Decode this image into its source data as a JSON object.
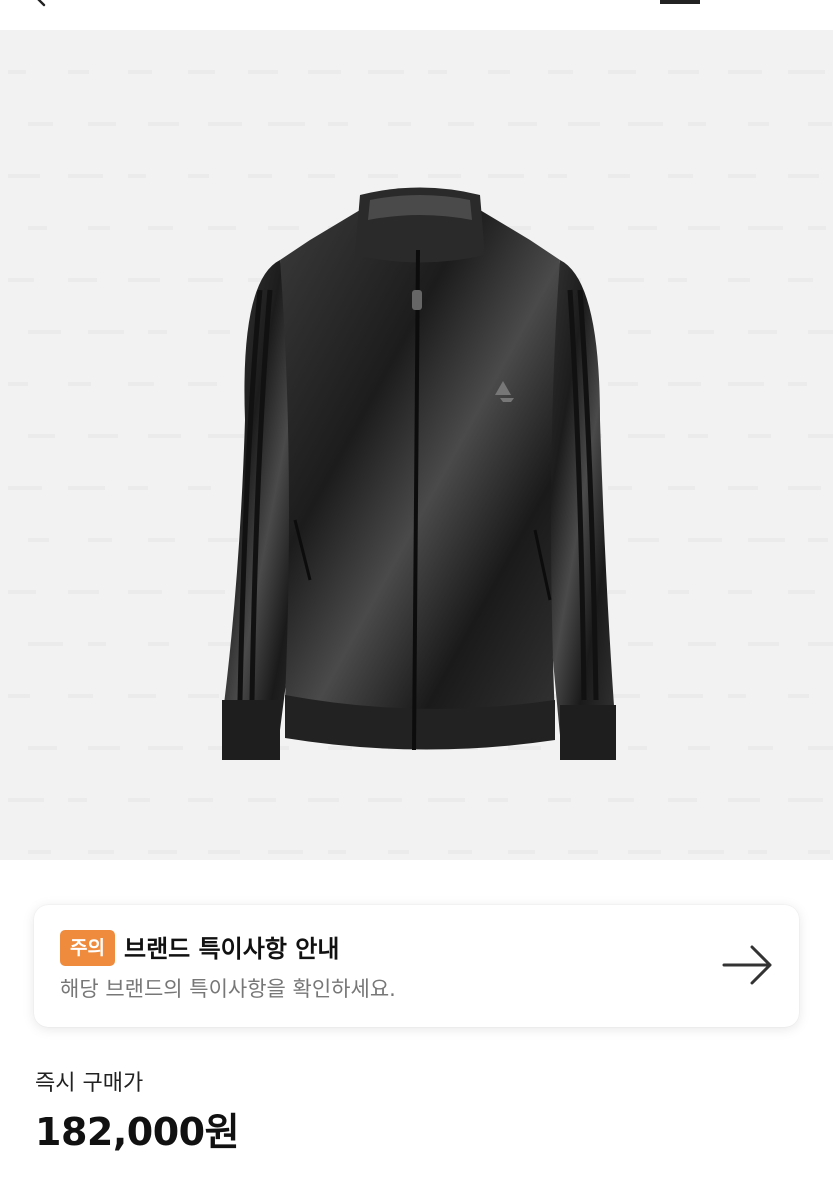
{
  "header": {
    "back_icon": "chevron-left-icon",
    "cart_icon": "menu-bar-icon"
  },
  "product_image": {
    "icon": "track-jacket-image",
    "background": "#f2f2f2"
  },
  "notice": {
    "badge": "주의",
    "badge_color": "#ef8b3c",
    "title": "브랜드 특이사항 안내",
    "subtitle": "해당 브랜드의 특이사항을 확인하세요.",
    "arrow_icon": "arrow-right-icon"
  },
  "price": {
    "label": "즉시 구매가",
    "value": "182,000원"
  }
}
